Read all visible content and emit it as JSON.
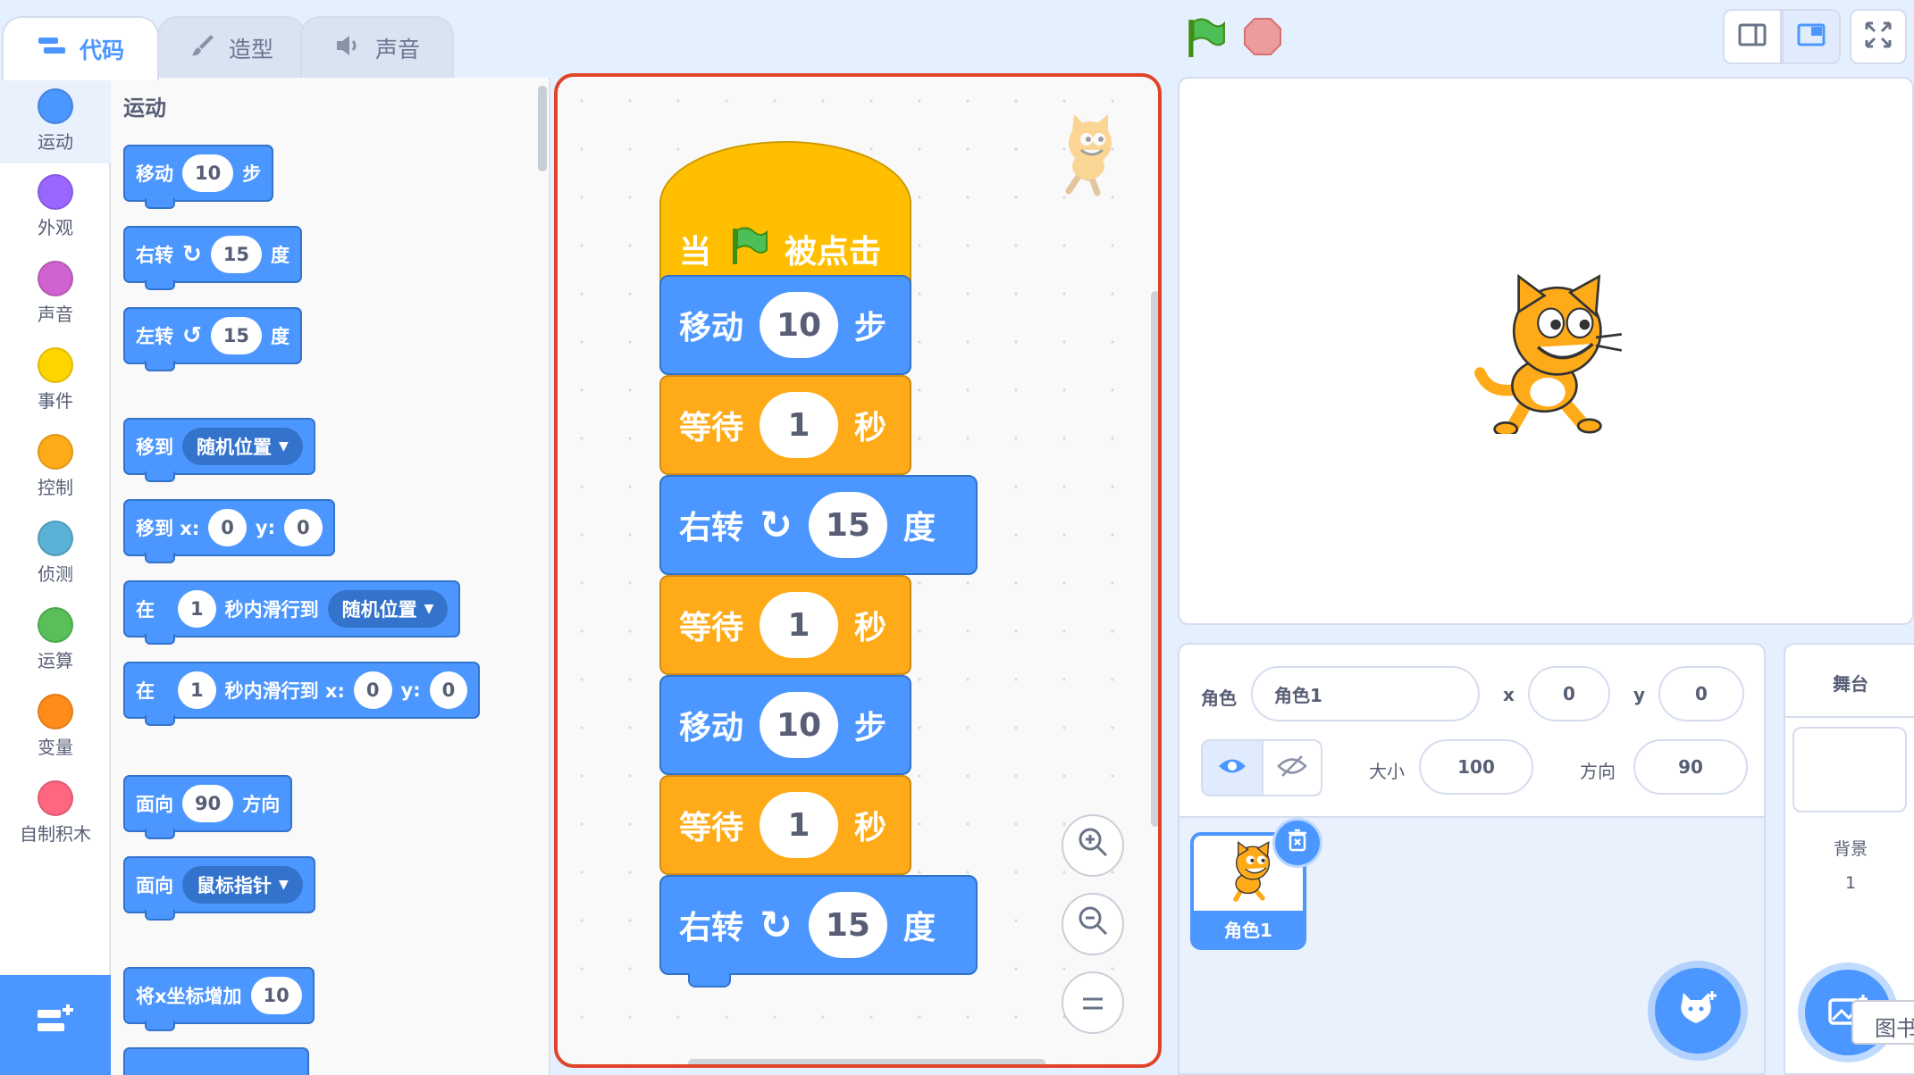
{
  "tabs": {
    "code": "代码",
    "costumes": "造型",
    "sounds": "声音"
  },
  "categories": [
    {
      "label": "运动",
      "color": "#4c97ff"
    },
    {
      "label": "外观",
      "color": "#9966ff"
    },
    {
      "label": "声音",
      "color": "#cf63cf"
    },
    {
      "label": "事件",
      "color": "#ffd500"
    },
    {
      "label": "控制",
      "color": "#ffab19"
    },
    {
      "label": "侦测",
      "color": "#5cb1d6"
    },
    {
      "label": "运算",
      "color": "#59c059"
    },
    {
      "label": "变量",
      "color": "#ff8c1a"
    },
    {
      "label": "自制积木",
      "color": "#ff6680"
    }
  ],
  "palette": {
    "title": "运动",
    "move": {
      "text": "移动",
      "value": "10",
      "unit": "步"
    },
    "turn_right": {
      "text": "右转",
      "value": "15",
      "unit": "度"
    },
    "turn_left": {
      "text": "左转",
      "value": "15",
      "unit": "度"
    },
    "goto": {
      "text": "移到",
      "option": "随机位置"
    },
    "goto_xy": {
      "text": "移到 x:",
      "x": "0",
      "ylabel": "y:",
      "y": "0"
    },
    "glide": {
      "text": "在",
      "secs": "1",
      "mid": "秒内滑行到",
      "option": "随机位置"
    },
    "glide_xy": {
      "text": "在",
      "secs": "1",
      "mid": "秒内滑行到 x:",
      "x": "0",
      "ylabel": "y:",
      "y": "0"
    },
    "point_dir": {
      "text": "面向",
      "value": "90",
      "unit": "方向"
    },
    "point_towards": {
      "text": "面向",
      "option": "鼠标指针"
    },
    "change_x": {
      "text": "将x坐标增加",
      "value": "10"
    }
  },
  "script": {
    "hat_when": "当",
    "hat_clicked": "被点击",
    "blocks": [
      {
        "kind": "motion",
        "text": "移动",
        "value": "10",
        "unit": "步"
      },
      {
        "kind": "control",
        "text": "等待",
        "value": "1",
        "unit": "秒"
      },
      {
        "kind": "motion",
        "text": "右转",
        "value": "15",
        "unit": "度"
      },
      {
        "kind": "control",
        "text": "等待",
        "value": "1",
        "unit": "秒"
      },
      {
        "kind": "motion",
        "text": "移动",
        "value": "10",
        "unit": "步"
      },
      {
        "kind": "control",
        "text": "等待",
        "value": "1",
        "unit": "秒"
      },
      {
        "kind": "motion",
        "text": "右转",
        "value": "15",
        "unit": "度"
      }
    ]
  },
  "sprite_info": {
    "sprite_label": "角色",
    "sprite_name": "角色1",
    "x_label": "x",
    "x": "0",
    "y_label": "y",
    "y": "0",
    "size_label": "大小",
    "size": "100",
    "direction_label": "方向",
    "direction": "90"
  },
  "sprite_list": {
    "items": [
      {
        "name": "角色1"
      }
    ]
  },
  "stage_panel": {
    "title": "舞台",
    "backdrop_label": "背景",
    "backdrop_count": "1"
  },
  "tooltip": "图书",
  "colors": {
    "motion": "#4c97ff",
    "control": "#ffab19",
    "event": "#ffbf00",
    "accent": "#4c97ff",
    "workspace_highlight": "#e0442a"
  }
}
